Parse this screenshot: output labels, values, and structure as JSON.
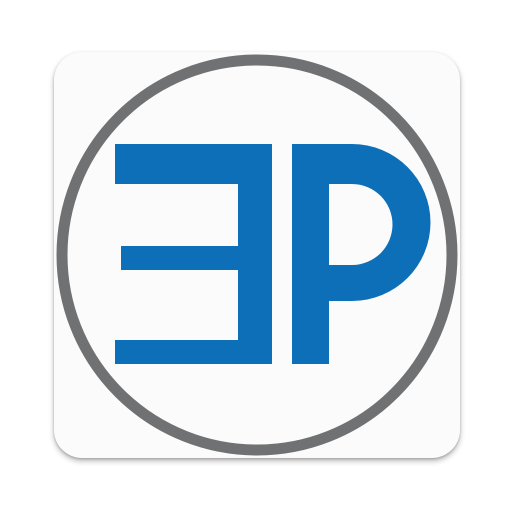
{
  "app_icon": {
    "logo": {
      "name": "ep-logo-icon",
      "ring_color": "#6f7173",
      "letter_color": "#0d6fb8",
      "background_color": "#fbfbfb"
    }
  }
}
